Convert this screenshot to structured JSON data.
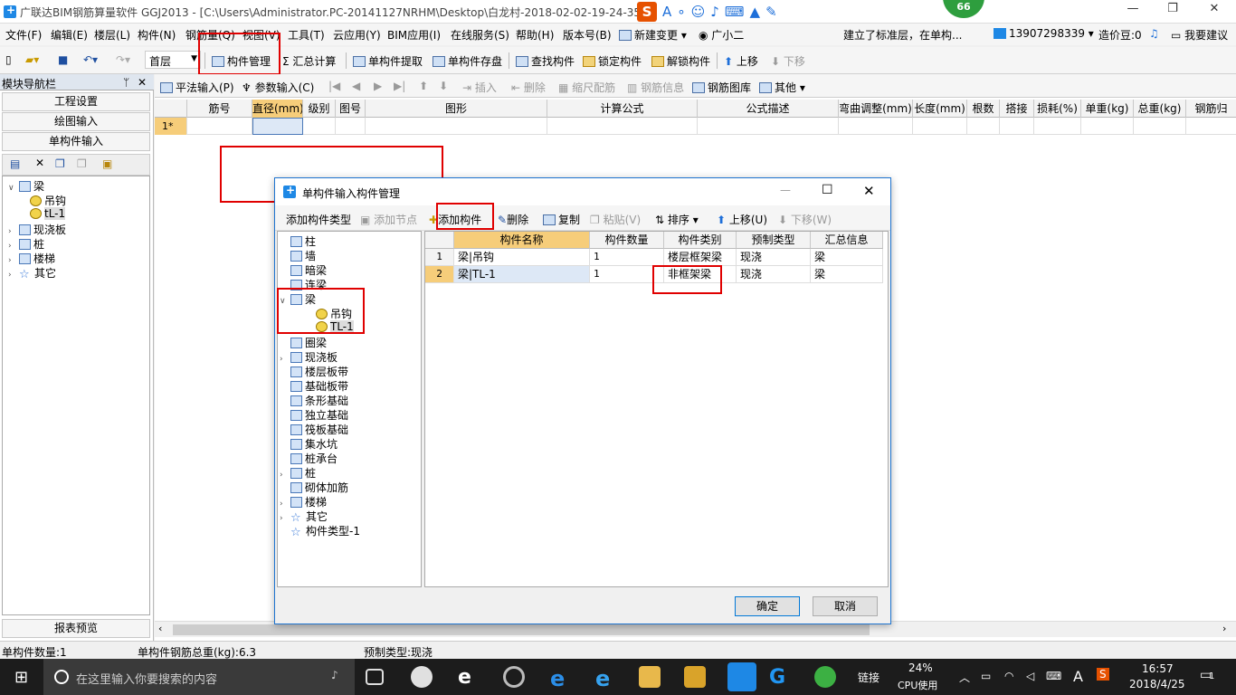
{
  "window": {
    "title": "广联达BIM钢筋算量软件 GGJ2013 - [C:\\Users\\Administrator.PC-20141127NRHM\\Desktop\\白龙村-2018-02-02-19-24-35",
    "minimize": "—",
    "restore": "❐",
    "close": "✕"
  },
  "ime_badge": "66",
  "menu": [
    "文件(F)",
    "编辑(E)",
    "楼层(L)",
    "构件(N)",
    "钢筋量(Q)",
    "视图(V)",
    "工具(T)",
    "云应用(Y)",
    "BIM应用(I)",
    "在线服务(S)",
    "帮助(H)",
    "版本号(B)",
    "新建变更",
    "广小二"
  ],
  "menu_right": {
    "notice": "建立了标准层，在单构...",
    "phone": "13907298339",
    "cost_beans": "造价豆:0",
    "suggest": "我要建议"
  },
  "toolbar": {
    "floor": "首层",
    "items": [
      "构件管理",
      "汇总计算",
      "单构件提取",
      "单构件存盘",
      "查找构件",
      "锁定构件",
      "解锁构件",
      "上移",
      "下移"
    ]
  },
  "nav": {
    "header": "模块导航栏",
    "pin": "ᛘ",
    "close": "✕",
    "buttons": [
      "工程设置",
      "绘图输入",
      "单构件输入"
    ],
    "report": "报表预览",
    "tree": [
      {
        "label": "梁",
        "expanded": true
      },
      {
        "label": "吊钩"
      },
      {
        "label": "tL-1",
        "selected": true
      },
      {
        "label": "现浇板"
      },
      {
        "label": "桩"
      },
      {
        "label": "楼梯"
      },
      {
        "label": "其它"
      }
    ]
  },
  "grid_toolbar": {
    "ping_fa": "平法输入(P)",
    "can_shu": "参数输入(C)",
    "insert": "插入",
    "delete": "删除",
    "zoom": "缩尺配筋",
    "rebar_info": "钢筋信息",
    "rebar_lib": "钢筋图库",
    "other": "其他"
  },
  "grid": {
    "columns": [
      "筋号",
      "直径(mm)",
      "级别",
      "图号",
      "图形",
      "计算公式",
      "公式描述",
      "弯曲调整(mm)",
      "长度(mm)",
      "根数",
      "搭接",
      "损耗(%)",
      "单重(kg)",
      "总重(kg)",
      "钢筋归"
    ],
    "row1": "1*"
  },
  "dialog": {
    "title": "单构件输入构件管理",
    "toolbar": [
      "添加构件类型",
      "添加节点",
      "添加构件",
      "删除",
      "复制",
      "粘贴(V)",
      "排序",
      "上移(U)",
      "下移(W)"
    ],
    "tree": [
      "柱",
      "墙",
      "暗梁",
      "连梁",
      "梁",
      "吊钩",
      "TL-1",
      "圈梁",
      "现浇板",
      "楼层板带",
      "基础板带",
      "条形基础",
      "独立基础",
      "筏板基础",
      "集水坑",
      "桩承台",
      "桩",
      "砌体加筋",
      "楼梯",
      "其它",
      "构件类型-1"
    ],
    "columns": [
      "构件名称",
      "构件数量",
      "构件类别",
      "预制类型",
      "汇总信息"
    ],
    "rows": [
      {
        "no": "1",
        "name": "梁|吊钩",
        "qty": "1",
        "category": "楼层框架梁",
        "prefab": "现浇",
        "summary": "梁"
      },
      {
        "no": "2",
        "name": "梁|TL-1",
        "qty": "1",
        "category": "非框架梁",
        "prefab": "现浇",
        "summary": "梁"
      }
    ],
    "ok": "确定",
    "cancel": "取消"
  },
  "status": {
    "count": "单构件数量:1",
    "weight": "单构件钢筋总重(kg):6.3",
    "prefab": "预制类型:现浇"
  },
  "taskbar": {
    "search_placeholder": "在这里输入你要搜索的内容",
    "link": "链接",
    "cpu_pct": "24%",
    "cpu_label": "CPU使用",
    "lang": "A",
    "time": "16:57",
    "date": "2018/4/25",
    "notif": "1"
  },
  "colors": {
    "highlight_red": "#e00000",
    "accent_blue": "#1e74d0",
    "header_selected": "#f6cd7a"
  }
}
